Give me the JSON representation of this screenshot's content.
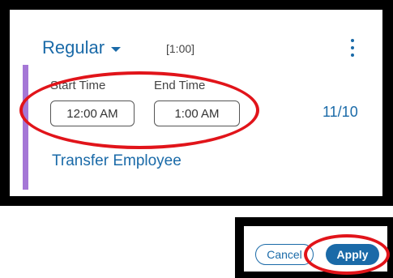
{
  "shift": {
    "type_label": "Regular",
    "duration": "[1:00]",
    "start_label": "Start Time",
    "start_value": "12:00 AM",
    "end_label": "End Time",
    "end_value": "1:00 AM",
    "date": "11/10",
    "transfer_link": "Transfer Employee"
  },
  "footer": {
    "cancel_label": "Cancel",
    "apply_label": "Apply"
  },
  "colors": {
    "accent": "#1a6aa8",
    "shift_bar": "#a577d6",
    "highlight": "#e1141a"
  }
}
